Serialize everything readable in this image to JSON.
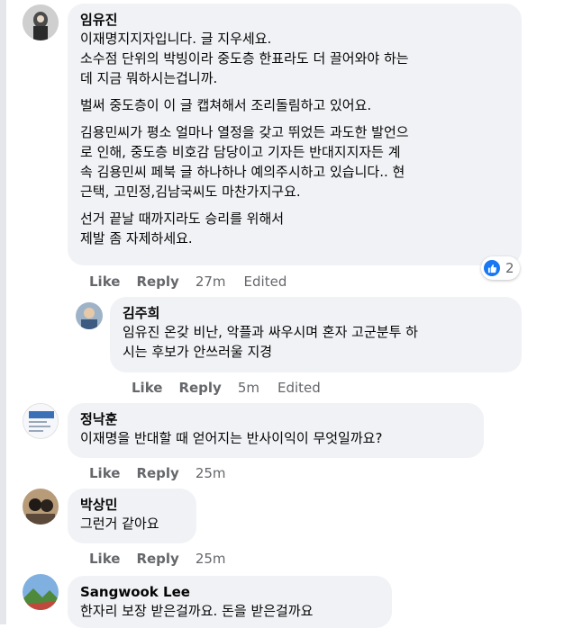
{
  "colors": {
    "bubble": "#f0f2f5",
    "action_text": "#65676b",
    "like_blue": "#1877f2"
  },
  "comments": [
    {
      "author": "임유진",
      "paragraphs": [
        "이재명지지자입니다. 글 지우세요.",
        "소수점 단위의 박빙이라 중도층 한표라도 더 끌어와야 하는\n데 지금 뭐하시는겁니까.",
        "벌써 중도층이 이 글 캡쳐해서 조리돌림하고 있어요.",
        "김용민씨가 평소 얼마나 열정을 갖고 뛰었든 과도한 발언으\n로 인해, 중도층 비호감 담당이고 기자든 반대지지자든 계\n속 김용민씨 페북 글 하나하나 예의주시하고 있습니다.. 현\n근택, 고민정,김남국씨도 마찬가지구요.",
        "선거 끝날 때까지라도 승리를 위해서\n제발 좀 자제하세요."
      ],
      "like": "Like",
      "reply": "Reply",
      "time": "27m",
      "edited": "Edited",
      "reactions": {
        "icon": "thumbs-up-icon",
        "count": "2"
      }
    },
    {
      "author": "김주희",
      "paragraphs": [
        "임유진 온갖 비난, 악플과 싸우시며 혼자 고군분투 하\n시는 후보가 안쓰러울 지경"
      ],
      "like": "Like",
      "reply": "Reply",
      "time": "5m",
      "edited": "Edited"
    },
    {
      "author": "정낙훈",
      "paragraphs": [
        "이재명을 반대할 때 얻어지는 반사이익이 무엇일까요?"
      ],
      "like": "Like",
      "reply": "Reply",
      "time": "25m"
    },
    {
      "author": "박상민",
      "paragraphs": [
        "그런거 같아요"
      ],
      "like": "Like",
      "reply": "Reply",
      "time": "25m"
    },
    {
      "author": "Sangwook Lee",
      "paragraphs": [
        "한자리 보장 받은걸까요. 돈을 받은걸까요"
      ]
    }
  ]
}
